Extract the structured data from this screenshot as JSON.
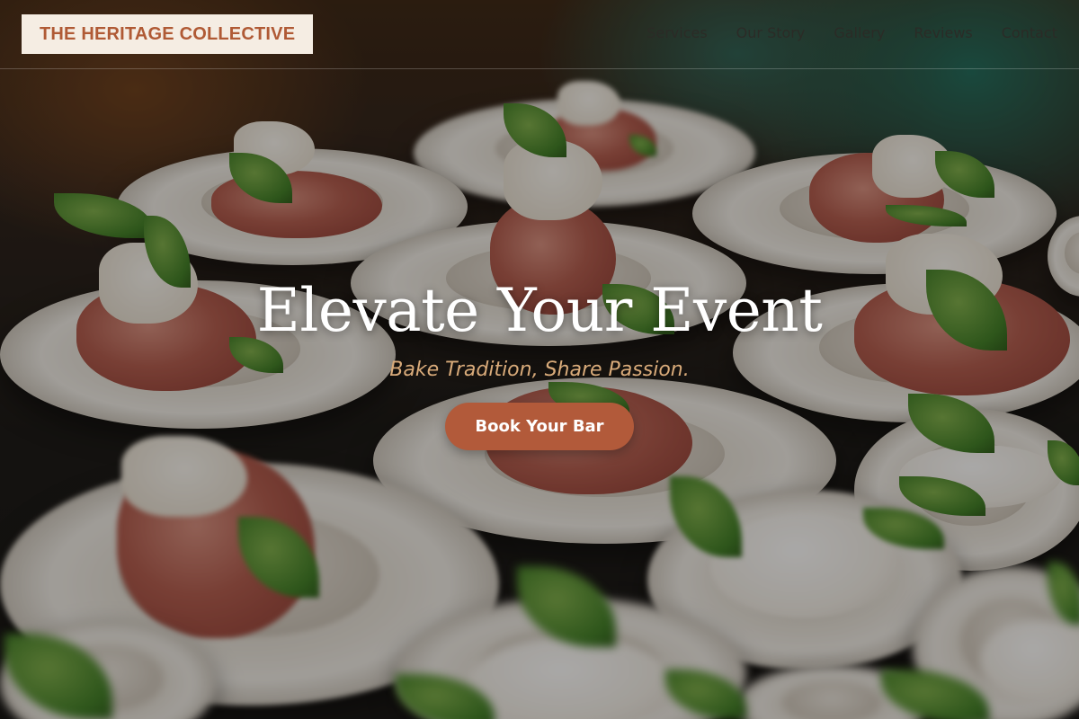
{
  "header": {
    "logo_text": "THE HERITAGE COLLECTIVE",
    "nav": [
      {
        "label": "Services"
      },
      {
        "label": "Our Story"
      },
      {
        "label": "Gallery"
      },
      {
        "label": "Reviews"
      },
      {
        "label": "Contact"
      }
    ]
  },
  "hero": {
    "title": "Elevate Your Event",
    "subtitle": "Bake Tradition, Share Passion.",
    "cta_label": "Book Your Bar",
    "background_image": "plates-of-prosciutto-and-burrata-photo"
  },
  "colors": {
    "logo_background": "#f5ede3",
    "logo_text": "#b05a35",
    "accent": "#b25a3a",
    "subtitle": "#d9ab7a",
    "title": "#ffffff"
  }
}
